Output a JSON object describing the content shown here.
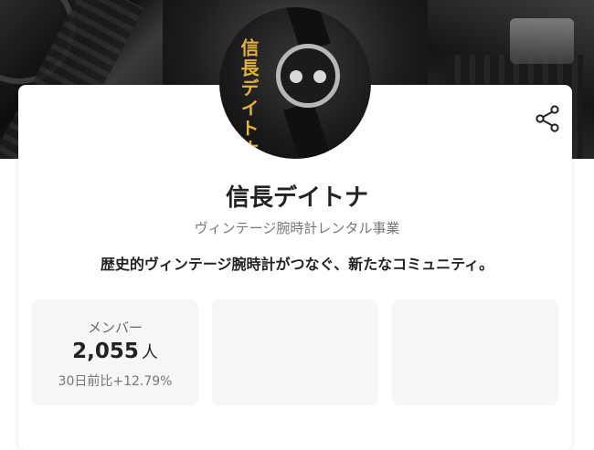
{
  "header": {
    "avatar_text": "信長デイトナ"
  },
  "profile": {
    "name": "信長デイトナ",
    "category": "ヴィンテージ腕時計レンタル事業",
    "tagline": "歴史的ヴィンテージ腕時計がつなぐ、新たなコミュニティ。"
  },
  "actions": {
    "share_icon": "share-icon"
  },
  "stats": [
    {
      "label": "メンバー",
      "value": "2,055",
      "unit": "人",
      "change": "30日前比+12.79%"
    },
    {
      "label": "",
      "value": "",
      "unit": "",
      "change": ""
    },
    {
      "label": "",
      "value": "",
      "unit": "",
      "change": ""
    }
  ]
}
